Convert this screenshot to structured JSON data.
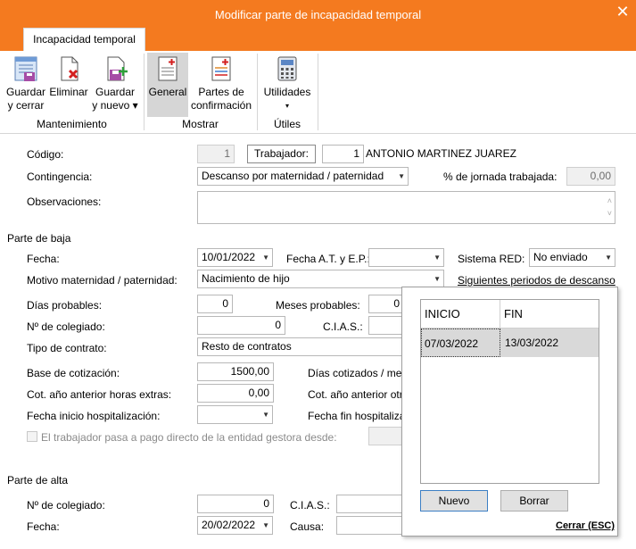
{
  "window": {
    "title": "Modificar parte de incapacidad temporal",
    "close_glyph": "✕"
  },
  "ribbon": {
    "tab": "Incapacidad temporal",
    "buttons": {
      "guardar_cerrar": [
        "Guardar",
        "y cerrar"
      ],
      "eliminar": "Eliminar",
      "guardar_nuevo": [
        "Guardar",
        "y nuevo ▾"
      ],
      "general": "General",
      "partes_confirmacion": [
        "Partes de",
        "confirmación"
      ],
      "utilidades": [
        "Utilidades",
        "▾"
      ]
    },
    "groups": {
      "mantenimiento": "Mantenimiento",
      "mostrar": "Mostrar",
      "utiles": "Útiles"
    }
  },
  "form": {
    "codigo_label": "Código:",
    "codigo_value": "1",
    "trabajador_button": "Trabajador:",
    "trabajador_code": "1",
    "trabajador_name": "ANTONIO MARTINEZ JUAREZ",
    "contingencia_label": "Contingencia:",
    "contingencia_value": "Descanso por maternidad / paternidad",
    "jornada_label": "% de jornada trabajada:",
    "jornada_value": "0,00",
    "observaciones_label": "Observaciones:",
    "observaciones_value": ""
  },
  "baja": {
    "section": "Parte de baja",
    "fecha_label": "Fecha:",
    "fecha_value": "10/01/2022",
    "fecha_at_label": "Fecha A.T. y E.P.:",
    "fecha_at_value": "",
    "sistema_red_label": "Sistema RED:",
    "sistema_red_value": "No enviado",
    "motivo_label": "Motivo maternidad / paternidad:",
    "motivo_value": "Nacimiento de hijo",
    "siguientes_link": "Siguientes periodos de descanso",
    "dias_probables_label": "Días probables:",
    "dias_probables_value": "0",
    "meses_probables_label": "Meses probables:",
    "meses_probables_value": "0",
    "colegiado_label": "Nº de colegiado:",
    "colegiado_value": "0",
    "cias_label": "C.I.A.S.:",
    "cias_value": "",
    "tipo_contrato_label": "Tipo de contrato:",
    "tipo_contrato_value": "Resto de contratos",
    "base_label": "Base de cotización:",
    "base_value": "1500,00",
    "dias_cotizados_label": "Días cotizados / mes",
    "cot_horas_label": "Cot. año anterior horas extras:",
    "cot_horas_value": "0,00",
    "cot_otras_label": "Cot. año anterior otr",
    "fecha_inicio_hosp_label": "Fecha inicio hospitalización:",
    "fecha_inicio_hosp_value": "",
    "fecha_fin_hosp_label": "Fecha fin hospitaliza",
    "pago_directo_label": "El trabajador pasa a pago directo de la entidad gestora desde:"
  },
  "alta": {
    "section": "Parte de alta",
    "colegiado_label": "Nº de colegiado:",
    "colegiado_value": "0",
    "cias_label": "C.I.A.S.:",
    "cias_value": "",
    "fecha_label": "Fecha:",
    "fecha_value": "20/02/2022",
    "causa_label": "Causa:",
    "causa_value": ""
  },
  "popup": {
    "columns": [
      "INICIO",
      "FIN"
    ],
    "rows": [
      {
        "inicio": "07/03/2022",
        "fin": "13/03/2022"
      }
    ],
    "nuevo_button": "Nuevo",
    "borrar_button": "Borrar",
    "cerrar_link": "Cerrar (ESC)"
  },
  "colors": {
    "accent": "#f47a1f",
    "selected": "#d9d9d9"
  }
}
